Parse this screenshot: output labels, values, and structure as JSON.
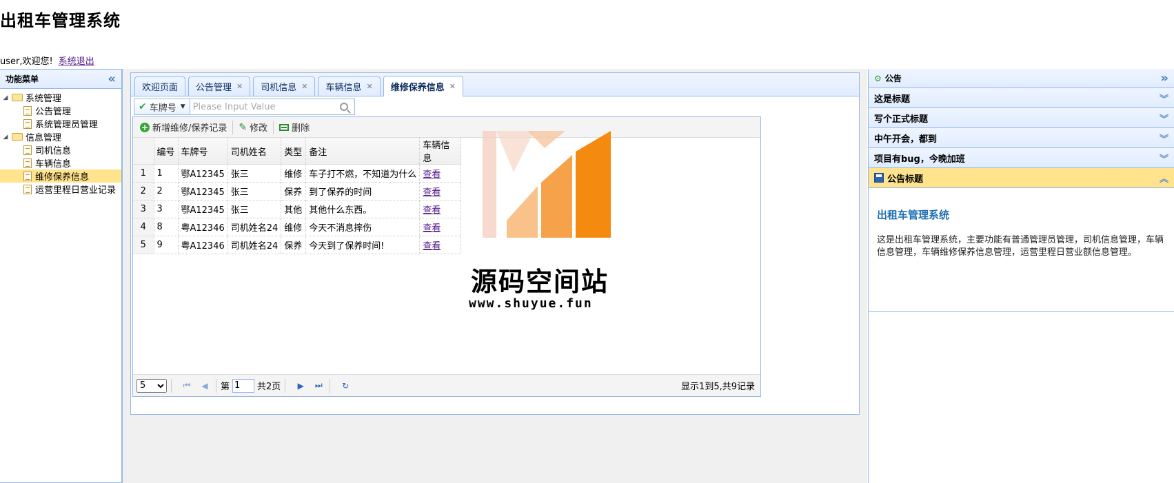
{
  "app": {
    "title": "出租车管理系统"
  },
  "user": {
    "greeting": "user,欢迎您!",
    "logout": "系统退出"
  },
  "west": {
    "title": "功能菜单",
    "tree": [
      {
        "label": "系统管理",
        "children": [
          "公告管理",
          "系统管理员管理"
        ]
      },
      {
        "label": "信息管理",
        "children": [
          "司机信息",
          "车辆信息",
          "维修保养信息",
          "运营里程日营业记录"
        ]
      }
    ],
    "selected": "维修保养信息"
  },
  "tabs": [
    {
      "label": "欢迎页面",
      "closable": false
    },
    {
      "label": "公告管理",
      "closable": true
    },
    {
      "label": "司机信息",
      "closable": true
    },
    {
      "label": "车辆信息",
      "closable": true
    },
    {
      "label": "维修保养信息",
      "closable": true,
      "active": true
    }
  ],
  "search": {
    "field": "车牌号",
    "placeholder": "Please Input Value"
  },
  "toolbar": {
    "add": "新增维修/保养记录",
    "edit": "修改",
    "delete": "删除"
  },
  "grid": {
    "columns": [
      "编号",
      "车牌号",
      "司机姓名",
      "类型",
      "备注",
      "车辆信息"
    ],
    "rows": [
      {
        "rn": "1",
        "id": "1",
        "plate": "鄂A12345",
        "driver": "张三",
        "type": "维修",
        "note": "车子打不燃，不知道为什么",
        "link": "查看"
      },
      {
        "rn": "2",
        "id": "2",
        "plate": "鄂A12345",
        "driver": "张三",
        "type": "保养",
        "note": "到了保养的时间",
        "link": "查看"
      },
      {
        "rn": "3",
        "id": "3",
        "plate": "鄂A12345",
        "driver": "张三",
        "type": "其他",
        "note": "其他什么东西。",
        "link": "查看"
      },
      {
        "rn": "4",
        "id": "8",
        "plate": "粤A12346",
        "driver": "司机姓名24",
        "type": "维修",
        "note": "今天不消息摔伤",
        "link": "查看"
      },
      {
        "rn": "5",
        "id": "9",
        "plate": "粤A12346",
        "driver": "司机姓名24",
        "type": "保养",
        "note": "今天到了保养时间!",
        "link": "查看"
      }
    ]
  },
  "pager": {
    "page_size": "5",
    "page_prefix": "第",
    "page": "1",
    "total_pages": "共2页",
    "info": "显示1到5,共9记录"
  },
  "watermark": {
    "text": "源码空间站",
    "url": "www.shuyue.fun"
  },
  "east": {
    "title": "公告",
    "items": [
      "这是标题",
      "写个正式标题",
      "中午开会，都到",
      "项目有bug，今晚加班"
    ],
    "active_title": "公告标题",
    "body_heading": "出租车管理系统",
    "body_text": "这是出租车管理系统，主要功能有普通管理员管理，司机信息管理，车辆信息管理，车辆维修保养信息管理，运营里程日营业额信息管理。"
  },
  "colors": {
    "border": "#95b8e7",
    "highlight": "#ffe48d",
    "link": "#551a8b",
    "heading": "#1e6fb5"
  }
}
